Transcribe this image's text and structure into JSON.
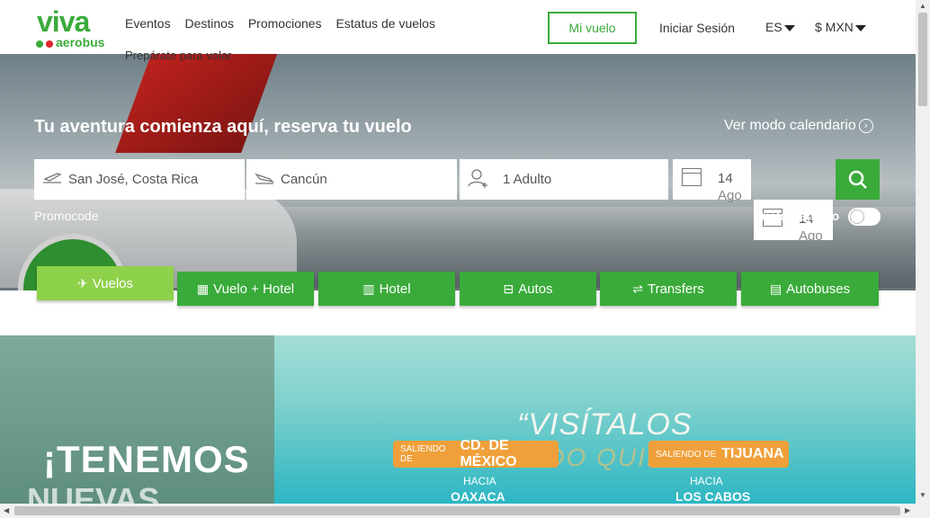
{
  "header": {
    "logo_text": "viva",
    "logo_sub": "aerobus",
    "nav": [
      "Eventos",
      "Destinos",
      "Promociones",
      "Estatus de vuelos"
    ],
    "nav_second": "Prepárate para volar",
    "mi_vuelo": "Mi vuelo",
    "login": "Iniciar Sesión",
    "language": "ES",
    "currency": "$ MXN"
  },
  "search": {
    "title": "Tu aventura comienza aquí, reserva tu vuelo",
    "calendar_link": "Ver modo calendario",
    "origin": "San José, Costa Rica",
    "destination": "Cancún",
    "passengers": "1 Adulto",
    "depart_day": "14",
    "depart_month": "Ago",
    "return_day": "14",
    "return_month": "Ago",
    "promocode": "Promocode",
    "one_way": "Vuelo Sencillo"
  },
  "tabs": [
    "Vuelos",
    "Vuelo + Hotel",
    "Hotel",
    "Autos",
    "Transfers",
    "Autobuses"
  ],
  "banner": {
    "left_title": "¡TENEMOS",
    "left_sub": "NUEVAS",
    "headline": "“VISÍTALOS",
    "headline2": "CUANDO QUIERAS",
    "pill1_prefix": "SALIENDO DE",
    "pill1_city": "CD. DE MÉXICO",
    "pill2_prefix": "SALIENDO DE",
    "pill2_city": "TIJUANA",
    "hacia1": "HACIA",
    "city1": "OAXACA",
    "hacia2": "HACIA",
    "city2": "LOS CABOS"
  },
  "colors": {
    "brand_green": "#3aab3a",
    "light_green": "#8ed14a",
    "brand_red": "#e0262a"
  }
}
